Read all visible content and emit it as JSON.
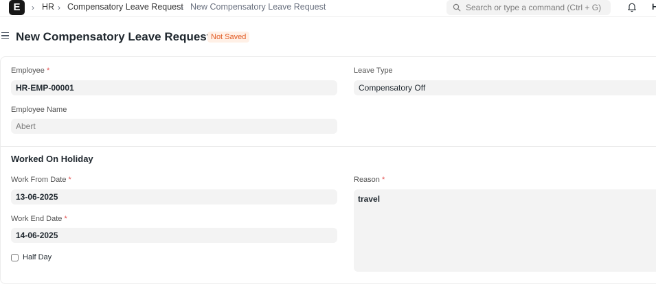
{
  "navbar": {
    "logo_letter": "E",
    "breadcrumbs": [
      "HR",
      "Compensatory Leave Request",
      "New Compensatory Leave Request"
    ],
    "search_placeholder": "Search or type a command (Ctrl + G)",
    "avatar_letter": "H"
  },
  "page": {
    "title": "New Compensatory Leave Request",
    "status_badge": "Not Saved"
  },
  "form": {
    "employee": {
      "label": "Employee",
      "required": "*",
      "value": "HR-EMP-00001"
    },
    "leave_type": {
      "label": "Leave Type",
      "value": "Compensatory Off"
    },
    "employee_name": {
      "label": "Employee Name",
      "value": "Abert"
    },
    "section_title": "Worked On Holiday",
    "work_from_date": {
      "label": "Work From Date",
      "required": "*",
      "value": "13-06-2025"
    },
    "work_end_date": {
      "label": "Work End Date",
      "required": "*",
      "value": "14-06-2025"
    },
    "half_day": {
      "label": "Half Day",
      "checked": false
    },
    "reason": {
      "label": "Reason",
      "required": "*",
      "value": "travel"
    }
  }
}
